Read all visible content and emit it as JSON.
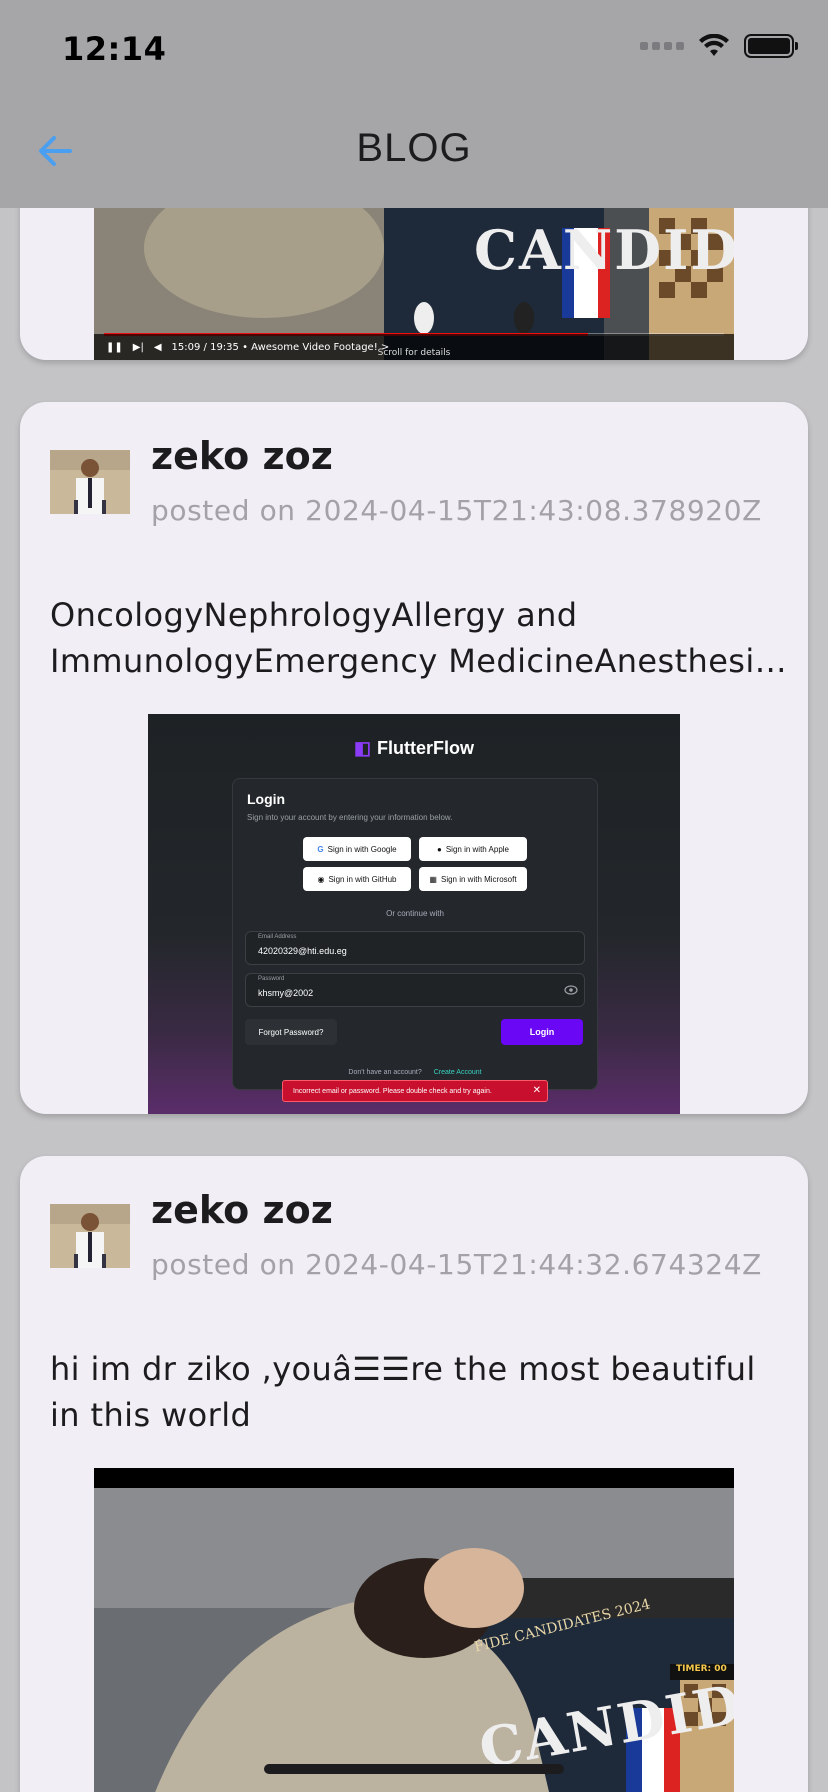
{
  "status_bar": {
    "time": "12:14"
  },
  "app_bar": {
    "title": "BLOG",
    "back_icon": "arrow-left-icon",
    "accent": "#4a9ff0"
  },
  "posts": [
    {
      "media": {
        "type": "video",
        "overlay_text": "CANDID",
        "time_display": "15:09 / 19:35 • Awesome Video Footage! >",
        "hint": "Scroll for details",
        "played_fraction": 0.78
      }
    },
    {
      "author": "zeko zoz",
      "date": "posted on 2024-04-15T21:43:08.378920Z",
      "body": "OncologyNephrologyAllergy and ImmunologyEmergency MedicineAnesthesiol…",
      "media": {
        "type": "screenshot",
        "brand": "FlutterFlow",
        "login_title": "Login",
        "login_subtitle": "Sign into your account by entering your information below.",
        "sso": [
          "Sign in with Google",
          "Sign in with Apple",
          "Sign in with GitHub",
          "Sign in with Microsoft"
        ],
        "or_text": "Or continue with",
        "email_label": "Email Address",
        "email_value": "42020329@hti.edu.eg",
        "password_label": "Password",
        "password_value": "khsmy@2002",
        "forgot": "Forgot Password?",
        "login_button": "Login",
        "no_account": "Don't have an account?",
        "create_account": "Create Account",
        "error": "Incorrect email or password. Please double check and try again."
      }
    },
    {
      "author": "zeko zoz",
      "date": "posted on 2024-04-15T21:44:32.674324Z",
      "body": "hi im dr ziko ,youâ☰☰re the most beautiful in this world",
      "media": {
        "type": "video",
        "overlay_text": "CANDID",
        "banner": "FIDE CANDIDATES 2024",
        "timer": "TIMER: 00"
      }
    }
  ]
}
